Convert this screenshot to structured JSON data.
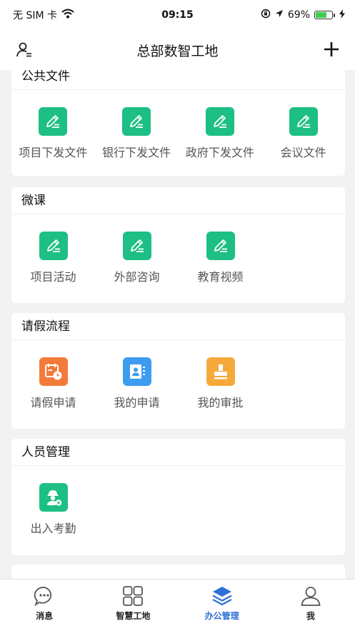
{
  "status_bar": {
    "carrier": "无 SIM 卡",
    "time": "09:15",
    "battery_percent": "69%",
    "battery_level": 0.69
  },
  "nav": {
    "title": "总部数智工地"
  },
  "sections": [
    {
      "title": "公共文件",
      "items": [
        {
          "label": "项目下发文件",
          "icon": "document-edit-icon",
          "color": "#1dbf84"
        },
        {
          "label": "银行下发文件",
          "icon": "document-edit-icon",
          "color": "#1dbf84"
        },
        {
          "label": "政府下发文件",
          "icon": "document-edit-icon",
          "color": "#1dbf84"
        },
        {
          "label": "会议文件",
          "icon": "document-edit-icon",
          "color": "#1dbf84"
        }
      ]
    },
    {
      "title": "微课",
      "items": [
        {
          "label": "项目活动",
          "icon": "document-edit-icon",
          "color": "#1dbf84"
        },
        {
          "label": "外部咨询",
          "icon": "document-edit-icon",
          "color": "#1dbf84"
        },
        {
          "label": "教育视频",
          "icon": "document-edit-icon",
          "color": "#1dbf84"
        }
      ]
    },
    {
      "title": "请假流程",
      "items": [
        {
          "label": "请假申请",
          "icon": "calendar-clock-icon",
          "color": "#f47a3a"
        },
        {
          "label": "我的申请",
          "icon": "contact-card-icon",
          "color": "#3d9cf0"
        },
        {
          "label": "我的审批",
          "icon": "stamp-icon",
          "color": "#f6a93a"
        }
      ]
    },
    {
      "title": "人员管理",
      "items": [
        {
          "label": "出入考勤",
          "icon": "worker-settings-icon",
          "color": "#1dbf84"
        }
      ]
    }
  ],
  "tabs": [
    {
      "label": "消息",
      "icon": "chat-bubble-icon",
      "active": false
    },
    {
      "label": "智慧工地",
      "icon": "grid-icon",
      "active": false
    },
    {
      "label": "办公管理",
      "icon": "layers-icon",
      "active": true
    },
    {
      "label": "我",
      "icon": "person-icon",
      "active": false
    }
  ],
  "colors": {
    "accent": "#2f6fd6",
    "green": "#1dbf84",
    "orange": "#f47a3a",
    "blue": "#3d9cf0",
    "yellow": "#f6a93a"
  }
}
